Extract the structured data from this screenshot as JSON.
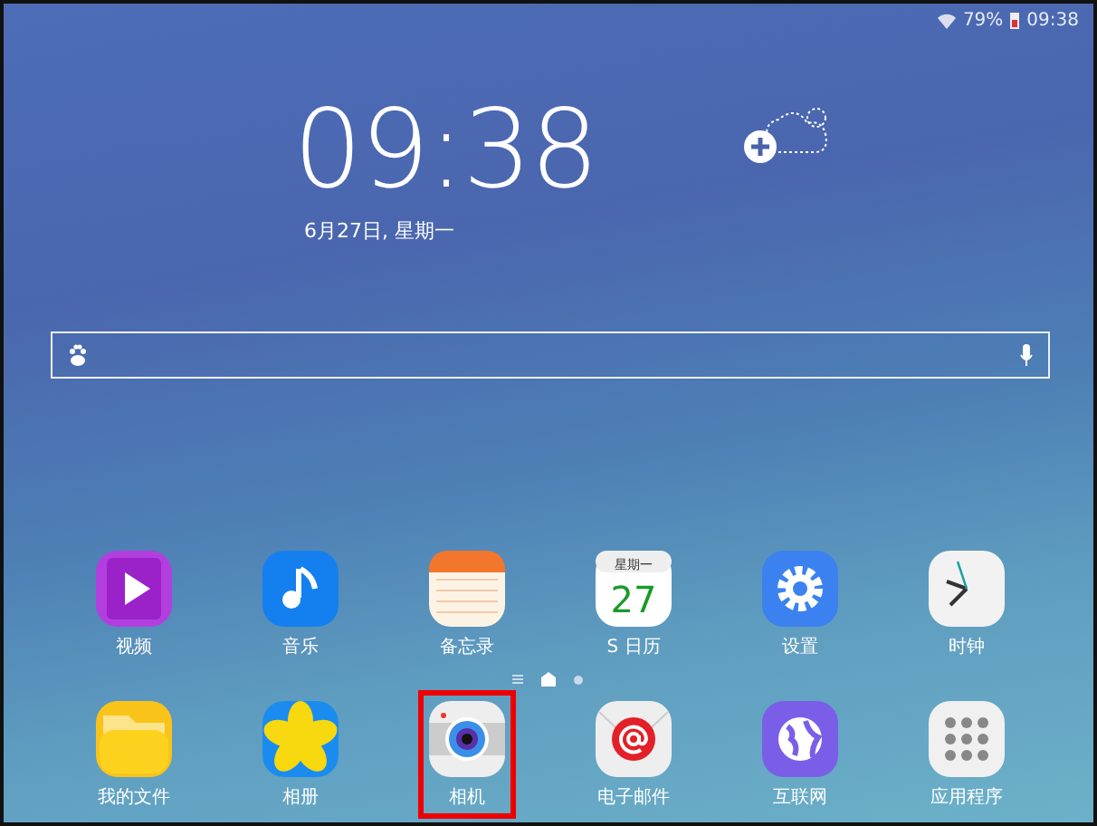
{
  "status_bar": {
    "battery": "79%",
    "time": "09:38"
  },
  "clock": {
    "time": "09:38",
    "date": "6月27日, 星期一"
  },
  "apps": [
    {
      "kind": "video",
      "label": "视频",
      "highlighted": false
    },
    {
      "kind": "music",
      "label": "音乐",
      "highlighted": false
    },
    {
      "kind": "memo",
      "label": "备忘录",
      "highlighted": false
    },
    {
      "kind": "calendar",
      "label": "S 日历",
      "icon_weekday": "星期一",
      "icon_day": "27",
      "highlighted": false
    },
    {
      "kind": "settings",
      "label": "设置",
      "highlighted": false
    },
    {
      "kind": "clock",
      "label": "时钟",
      "highlighted": false
    },
    {
      "kind": "files",
      "label": "我的文件",
      "highlighted": false
    },
    {
      "kind": "gallery",
      "label": "相册",
      "highlighted": false
    },
    {
      "kind": "camera",
      "label": "相机",
      "highlighted": true
    },
    {
      "kind": "email",
      "label": "电子邮件",
      "highlighted": false
    },
    {
      "kind": "internet",
      "label": "互联网",
      "highlighted": false
    },
    {
      "kind": "apps",
      "label": "应用程序",
      "highlighted": false
    }
  ],
  "page_indicators": [
    {
      "kind": "menu",
      "selected": false
    },
    {
      "kind": "home",
      "selected": true
    },
    {
      "kind": "page",
      "selected": false
    }
  ]
}
